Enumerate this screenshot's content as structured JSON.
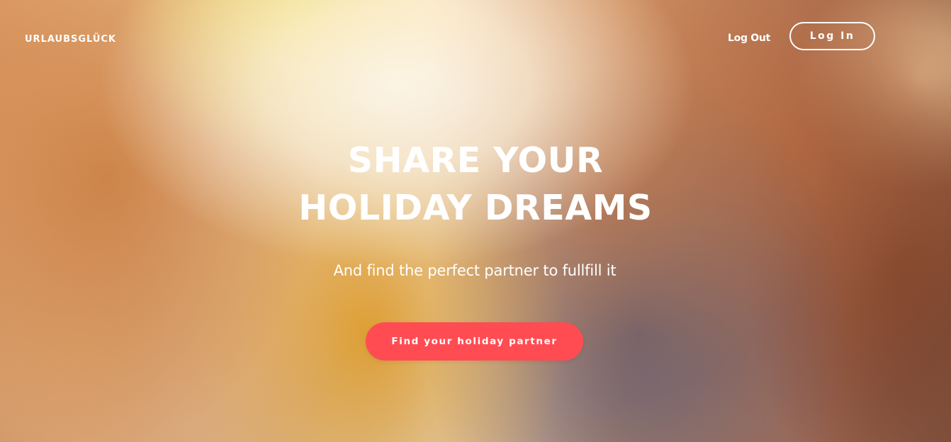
{
  "header": {
    "brand": "URLAUBSGLÜCK",
    "logout_label": "Log Out",
    "login_label": "Log In"
  },
  "hero": {
    "headline_line1": "SHARE YOUR",
    "headline_line2": "HOLIDAY DREAMS",
    "subline": "And find the perfect partner to fullfill it",
    "cta_label": "Find your holiday partner",
    "background_image": "photo-of-laughing-friends"
  },
  "colors": {
    "accent": "#ff4c52",
    "text": "#ffffff"
  }
}
